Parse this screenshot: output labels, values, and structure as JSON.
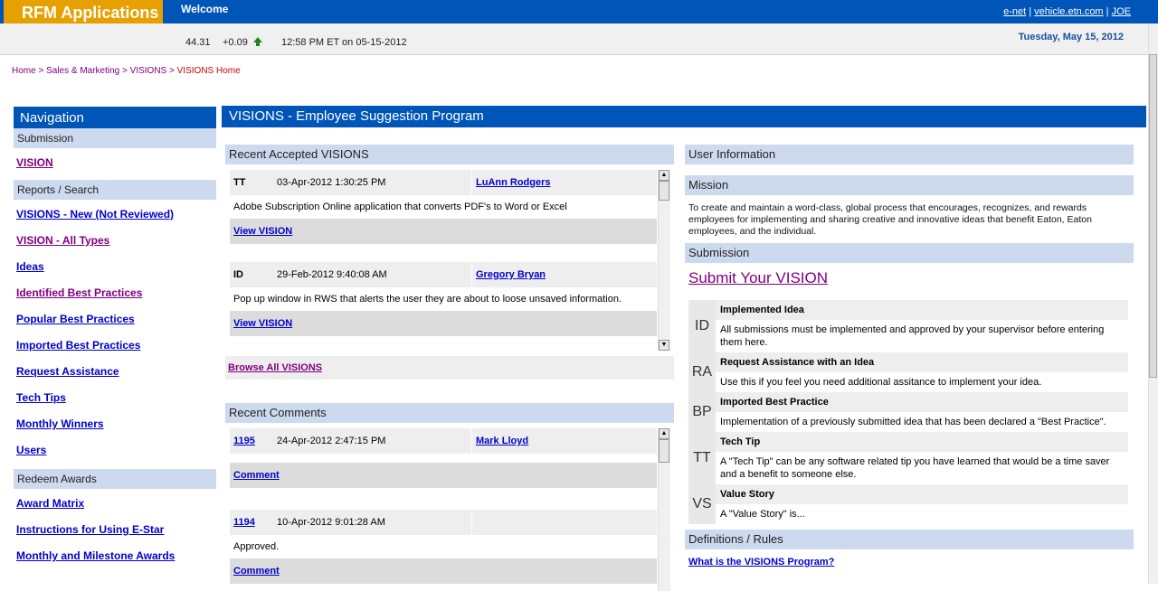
{
  "header": {
    "logo": "RFM Applications",
    "welcome": "Welcome",
    "links": [
      "e-net",
      "vehicle.etn.com",
      "JOE"
    ]
  },
  "ticker": {
    "price": "44.31",
    "change": "+0.09",
    "time": "12:58 PM ET on 05-15-2012",
    "date": "Tuesday, May 15, 2012"
  },
  "breadcrumb": {
    "items": [
      "Home",
      "Sales & Marketing",
      "VISIONS"
    ],
    "current": "VISIONS Home",
    "separator": ">"
  },
  "nav": {
    "title": "Navigation",
    "sections": [
      {
        "label": "Submission",
        "links": [
          "VISION"
        ]
      },
      {
        "label": "Reports / Search",
        "links": [
          "VISIONS - New (Not Reviewed)",
          "VISION - All Types",
          "Ideas",
          "Identified Best Practices",
          "Popular Best Practices",
          "Imported Best Practices",
          "Request Assistance",
          "Tech Tips",
          "Monthly Winners",
          "Users"
        ]
      },
      {
        "label": "Redeem Awards",
        "links": [
          "Award Matrix",
          "Instructions for Using E-Star",
          "Monthly and Milestone Awards"
        ]
      }
    ]
  },
  "main": {
    "title": "VISIONS - Employee Suggestion Program",
    "recent_visions": {
      "title": "Recent Accepted VISIONS",
      "items": [
        {
          "type": "TT",
          "date": "03-Apr-2012 1:30:25 PM",
          "user": "LuAnn Rodgers",
          "text": "Adobe Subscription Online application that converts PDF's to Word or Excel",
          "link": "View VISION"
        },
        {
          "type": "ID",
          "date": "29-Feb-2012 9:40:08 AM",
          "user": "Gregory Bryan",
          "text": "Pop up window in RWS that alerts the user they are about to loose unsaved information.",
          "link": "View VISION"
        }
      ],
      "browse_all": "Browse All VISIONS"
    },
    "recent_comments": {
      "title": "Recent Comments",
      "items": [
        {
          "id": "1195",
          "date": "24-Apr-2012 2:47:15 PM",
          "user": "Mark Lloyd",
          "text": "",
          "link": "Comment"
        },
        {
          "id": "1194",
          "date": "10-Apr-2012 9:01:28 AM",
          "user": "",
          "text": "Approved.",
          "link": "Comment"
        }
      ]
    }
  },
  "right": {
    "user_info_title": "User Information",
    "mission_title": "Mission",
    "mission_text": "To create and maintain a word-class, global process that encourages, recognizes, and rewards employees for implementing and sharing creative and innovative ideas that benefit Eaton, Eaton employees, and the individual.",
    "submission_title": "Submission",
    "submit_link": "Submit Your VISION",
    "definitions": [
      {
        "abbr": "ID",
        "title": "Implemented Idea",
        "text": "All submissions must be implemented and approved by your supervisor before entering them here."
      },
      {
        "abbr": "RA",
        "title": "Request Assistance with an Idea",
        "text": "Use this if you feel you need additional assitance to implement your idea."
      },
      {
        "abbr": "BP",
        "title": "Imported Best Practice",
        "text": "Implementation of a previously submitted idea that has been declared a \"Best Practice\"."
      },
      {
        "abbr": "TT",
        "title": "Tech Tip",
        "text": "A \"Tech Tip\" can be any software related tip you have learned that would be a time saver and a benefit to someone else."
      },
      {
        "abbr": "VS",
        "title": "Value Story",
        "text": "A \"Value Story\" is..."
      }
    ],
    "rules_title": "Definitions / Rules",
    "rules_link": "What is the VISIONS Program?"
  },
  "colors": {
    "header_blue": "#0055b8",
    "logo_orange": "#e6a000",
    "section_bg": "#cdd9ee",
    "link": "#0000cc",
    "visited": "#800080"
  },
  "icons": {
    "up_arrow": "up-arrow-icon",
    "scroll_up": "scroll-up-icon",
    "scroll_down": "scroll-down-icon"
  }
}
